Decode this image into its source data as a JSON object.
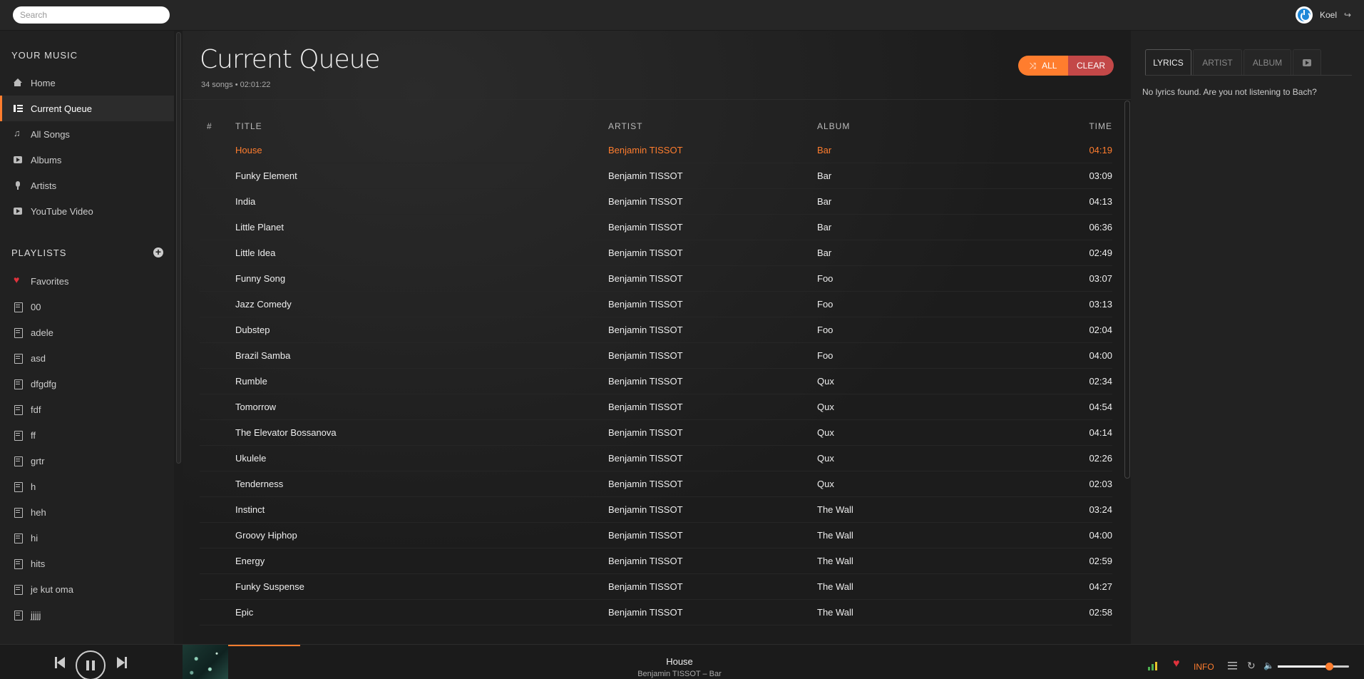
{
  "topbar": {
    "search_placeholder": "Search",
    "username": "Koel"
  },
  "sidebar": {
    "your_music_title": "YOUR MUSIC",
    "nav": [
      {
        "label": "Home",
        "icon": "home-icon"
      },
      {
        "label": "Current Queue",
        "icon": "queue-icon",
        "active": true
      },
      {
        "label": "All Songs",
        "icon": "note-icon"
      },
      {
        "label": "Albums",
        "icon": "album-icon"
      },
      {
        "label": "Artists",
        "icon": "mic-icon"
      },
      {
        "label": "YouTube Video",
        "icon": "youtube-icon"
      }
    ],
    "playlists_title": "PLAYLISTS",
    "playlists": [
      "Favorites",
      "00",
      "adele",
      "asd",
      "dfgdfg",
      "fdf",
      "ff",
      "grtr",
      "h",
      "heh",
      "hi",
      "hits",
      "je kut oma",
      "jjjjj"
    ]
  },
  "main": {
    "title": "Current Queue",
    "meta": "34 songs • 02:01:22",
    "shuffle_all_label": "ALL",
    "clear_label": "CLEAR",
    "columns": {
      "num": "#",
      "title": "TITLE",
      "artist": "ARTIST",
      "album": "ALBUM",
      "time": "TIME"
    },
    "songs": [
      {
        "title": "House",
        "artist": "Benjamin TISSOT",
        "album": "Bar",
        "time": "04:19",
        "playing": true
      },
      {
        "title": "Funky Element",
        "artist": "Benjamin TISSOT",
        "album": "Bar",
        "time": "03:09"
      },
      {
        "title": "India",
        "artist": "Benjamin TISSOT",
        "album": "Bar",
        "time": "04:13"
      },
      {
        "title": "Little Planet",
        "artist": "Benjamin TISSOT",
        "album": "Bar",
        "time": "06:36"
      },
      {
        "title": "Little Idea",
        "artist": "Benjamin TISSOT",
        "album": "Bar",
        "time": "02:49"
      },
      {
        "title": "Funny Song",
        "artist": "Benjamin TISSOT",
        "album": "Foo",
        "time": "03:07"
      },
      {
        "title": "Jazz Comedy",
        "artist": "Benjamin TISSOT",
        "album": "Foo",
        "time": "03:13"
      },
      {
        "title": "Dubstep",
        "artist": "Benjamin TISSOT",
        "album": "Foo",
        "time": "02:04"
      },
      {
        "title": "Brazil Samba",
        "artist": "Benjamin TISSOT",
        "album": "Foo",
        "time": "04:00"
      },
      {
        "title": "Rumble",
        "artist": "Benjamin TISSOT",
        "album": "Qux",
        "time": "02:34"
      },
      {
        "title": "Tomorrow",
        "artist": "Benjamin TISSOT",
        "album": "Qux",
        "time": "04:54"
      },
      {
        "title": "The Elevator Bossanova",
        "artist": "Benjamin TISSOT",
        "album": "Qux",
        "time": "04:14"
      },
      {
        "title": "Ukulele",
        "artist": "Benjamin TISSOT",
        "album": "Qux",
        "time": "02:26"
      },
      {
        "title": "Tenderness",
        "artist": "Benjamin TISSOT",
        "album": "Qux",
        "time": "02:03"
      },
      {
        "title": "Instinct",
        "artist": "Benjamin TISSOT",
        "album": "The Wall",
        "time": "03:24"
      },
      {
        "title": "Groovy Hiphop",
        "artist": "Benjamin TISSOT",
        "album": "The Wall",
        "time": "04:00"
      },
      {
        "title": "Energy",
        "artist": "Benjamin TISSOT",
        "album": "The Wall",
        "time": "02:59"
      },
      {
        "title": "Funky Suspense",
        "artist": "Benjamin TISSOT",
        "album": "The Wall",
        "time": "04:27"
      },
      {
        "title": "Epic",
        "artist": "Benjamin TISSOT",
        "album": "The Wall",
        "time": "02:58"
      }
    ]
  },
  "right_panel": {
    "tabs": {
      "lyrics": "LYRICS",
      "artist": "ARTIST",
      "album": "ALBUM"
    },
    "lyrics_text": "No lyrics found. Are you not listening to Bach?"
  },
  "player": {
    "now_playing_title": "House",
    "now_playing_sub": "Benjamin TISSOT – Bar",
    "progress": 0.08,
    "info_label": "INFO",
    "volume": 0.72
  },
  "colors": {
    "accent": "#ff7d2e",
    "danger": "#c34848",
    "favorite": "#e0323c"
  }
}
